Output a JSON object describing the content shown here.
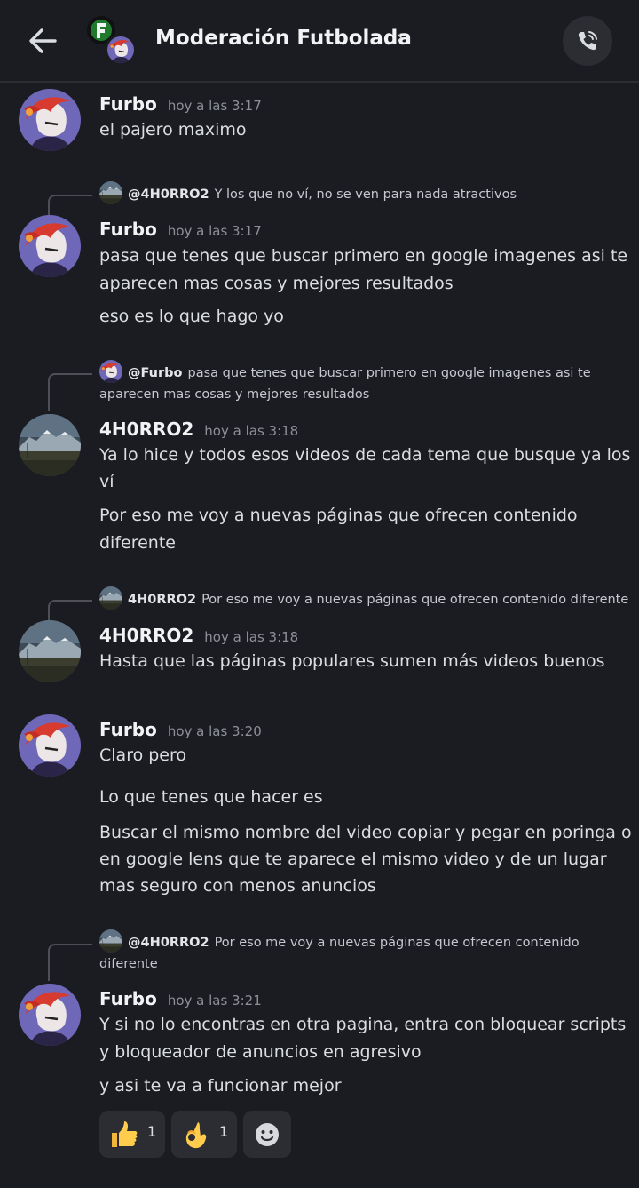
{
  "header": {
    "title": "Moderación Futbolada",
    "chevron": "›",
    "back_icon": "arrow-left-icon",
    "call_icon": "phone-call-icon"
  },
  "colors": {
    "background": "#1b1c22",
    "text": "#dbdee1",
    "muted": "#8d9097",
    "surface": "#2b2d33"
  },
  "messages": [
    {
      "author": "Furbo",
      "time": "hoy a las 3:17",
      "lines": [
        "el pajero maximo"
      ]
    },
    {
      "reply": {
        "name": "@4H0RRO2",
        "text": "Y los que no ví, no se ven para nada atractivos"
      },
      "author": "Furbo",
      "time": "hoy a las 3:17",
      "lines": [
        "pasa que tenes que buscar primero en google imagenes asi te",
        "aparecen mas cosas y mejores resultados",
        "eso es lo que hago yo"
      ]
    },
    {
      "reply": {
        "name": "@Furbo",
        "text_line1": "pasa que tenes que buscar primero en google imagenes asi te",
        "text_line2": "aparecen mas cosas y mejores resultados"
      },
      "author": "4H0RRO2",
      "time": "hoy a las 3:18",
      "lines": [
        "Ya lo hice y todos esos videos de cada tema que busque ya los",
        "ví",
        "Por eso me voy a nuevas páginas que ofrecen contenido",
        "diferente"
      ]
    },
    {
      "reply": {
        "name": "4H0RRO2",
        "text": "Por eso me voy a nuevas páginas que ofrecen contenido diferente"
      },
      "author": "4H0RRO2",
      "time": "hoy a las 3:18",
      "lines": [
        "Hasta que las páginas populares sumen más videos buenos"
      ]
    },
    {
      "author": "Furbo",
      "time": "hoy a las 3:20",
      "lines": [
        "Claro pero",
        "Lo que tenes que hacer es",
        "Buscar el mismo nombre del video copiar y pegar en poringa o",
        "en google lens que te aparece el mismo video y de un lugar",
        "mas seguro con menos anuncios"
      ]
    },
    {
      "reply": {
        "name": "@4H0RRO2",
        "text_line1": "Por eso me voy a nuevas páginas que ofrecen contenido",
        "text_line2": "diferente"
      },
      "author": "Furbo",
      "time": "hoy a las 3:21",
      "lines": [
        "Y si no lo encontras en otra pagina, entra con bloquear scripts",
        "y bloqueador de anuncios en agresivo",
        "y asi te va a funcionar mejor"
      ]
    }
  ],
  "reactions": [
    {
      "icon": "thumbs-up-icon",
      "count": "1"
    },
    {
      "icon": "ok-hand-icon",
      "count": "1"
    },
    {
      "icon": "add-reaction-icon"
    }
  ]
}
